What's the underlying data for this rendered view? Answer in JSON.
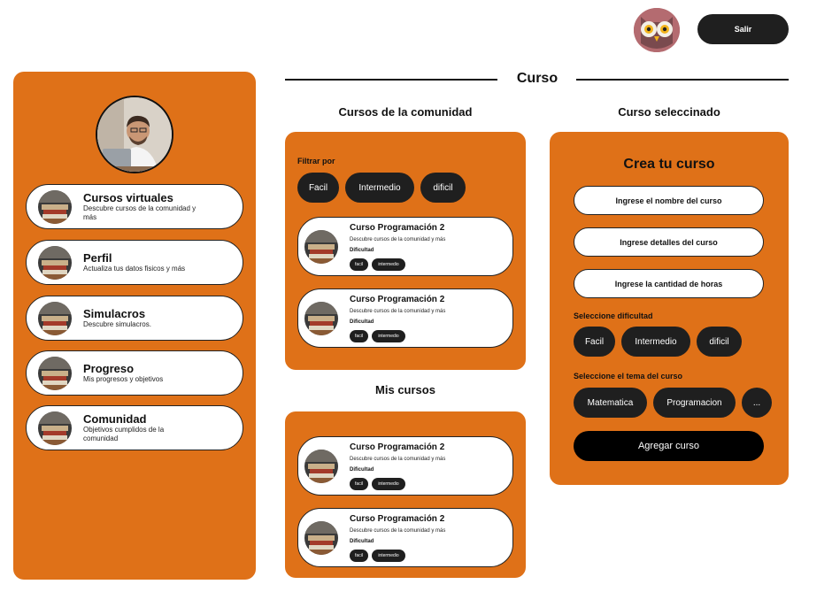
{
  "header": {
    "exit_label": "Salir",
    "owl_icon": "owl-icon"
  },
  "page_title": "Curso",
  "sidebar": {
    "items": [
      {
        "title": "Cursos virtuales",
        "desc": "Descubre cursos de la comunidad y más"
      },
      {
        "title": "Perfil",
        "desc": "Actualiza tus datos fisicos y más"
      },
      {
        "title": "Simulacros",
        "desc": "Descubre simulacros."
      },
      {
        "title": "Progreso",
        "desc": "Mis progresos y objetivos"
      },
      {
        "title": "Comunidad",
        "desc": "Objetivos cumplidos de la comunidad"
      }
    ]
  },
  "community": {
    "title": "Cursos de la comunidad",
    "filter_label": "Filtrar por",
    "filters": [
      "Facil",
      "Intermedio",
      "dificil"
    ],
    "courses": [
      {
        "title": "Curso Programación 2",
        "desc": "Descubre cursos de la comunidad y más",
        "difficulty_label": "Dificultad",
        "tags": [
          "facil",
          "intermedio"
        ]
      },
      {
        "title": "Curso Programación 2",
        "desc": "Descubre cursos de la comunidad y más",
        "difficulty_label": "Dificultad",
        "tags": [
          "facil",
          "intermedio"
        ]
      }
    ]
  },
  "my_courses": {
    "title": "Mis cursos",
    "courses": [
      {
        "title": "Curso Programación 2",
        "desc": "Descubre cursos de la comunidad y más",
        "difficulty_label": "Dificultad",
        "tags": [
          "facil",
          "intermedio"
        ]
      },
      {
        "title": "Curso Programación 2",
        "desc": "Descubre cursos de la comunidad y más",
        "difficulty_label": "Dificultad",
        "tags": [
          "facil",
          "intermedio"
        ]
      }
    ]
  },
  "selected": {
    "title": "Curso seleccinado",
    "form_title": "Crea tu curso",
    "name_placeholder": "Ingrese el nombre del curso",
    "details_placeholder": "Ingrese detalles del curso",
    "hours_placeholder": "Ingrese la cantidad de horas",
    "difficulty_label": "Seleccione dificultad",
    "difficulties": [
      "Facil",
      "Intermedio",
      "dificil"
    ],
    "topic_label": "Seleccione el tema del curso",
    "topics": [
      "Matematica",
      "Programacion",
      "..."
    ],
    "submit_label": "Agregar curso"
  },
  "colors": {
    "accent": "#df7118",
    "dark": "#1f1f1f"
  }
}
